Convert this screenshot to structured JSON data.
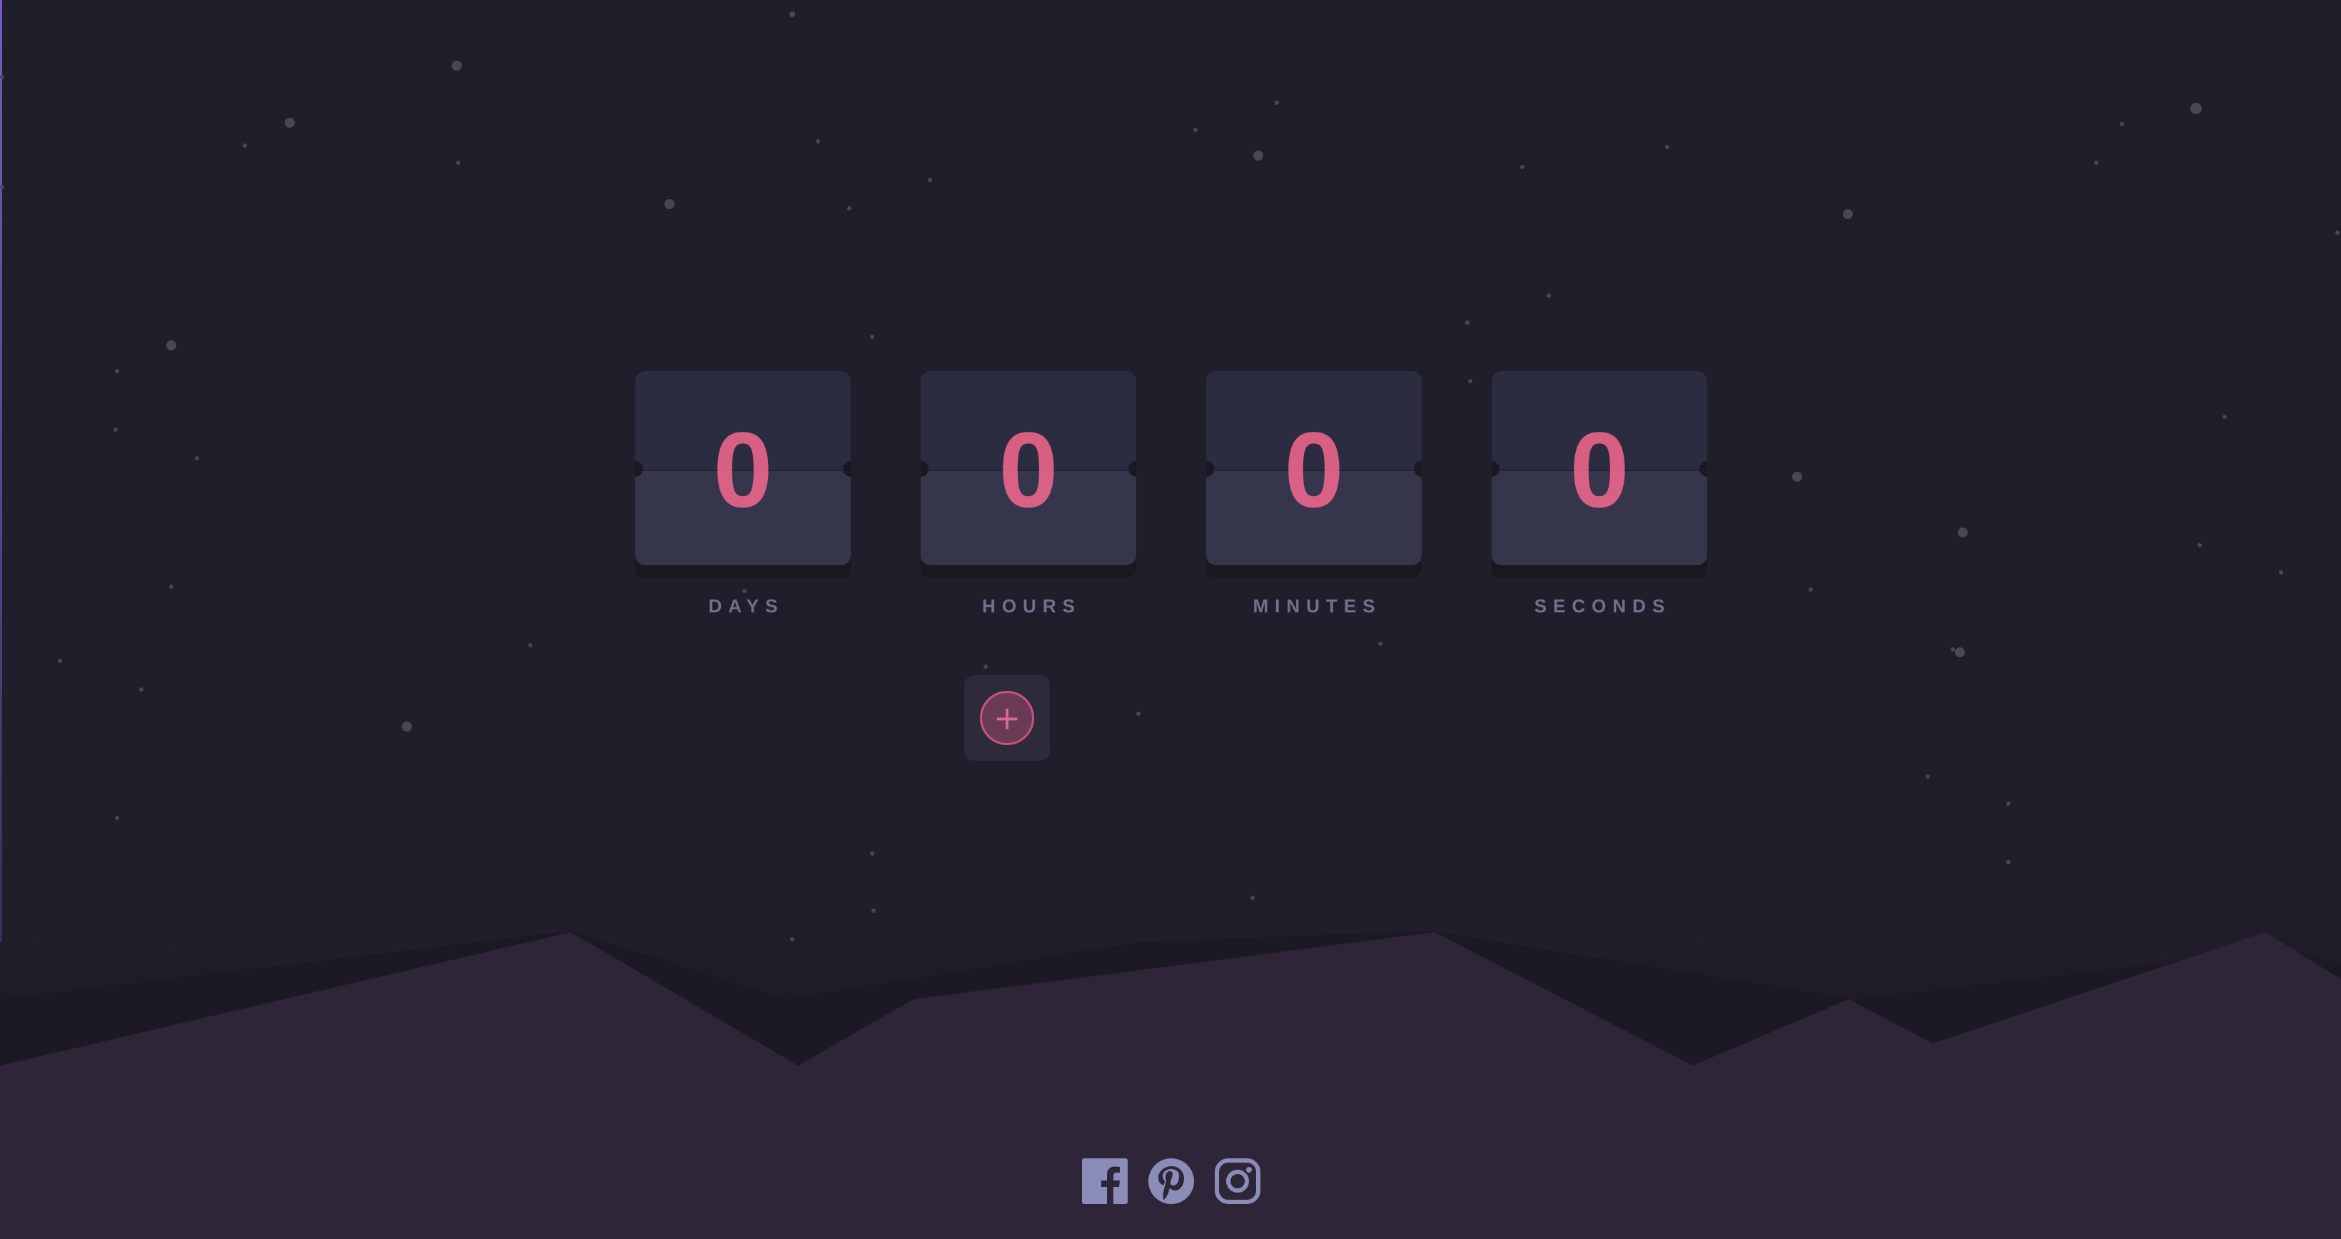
{
  "countdown": {
    "units": [
      {
        "id": "days",
        "value": "0",
        "label": "DAYS"
      },
      {
        "id": "hours",
        "value": "0",
        "label": "HOURS"
      },
      {
        "id": "minutes",
        "value": "0",
        "label": "MINUTES"
      },
      {
        "id": "seconds",
        "value": "0",
        "label": "SECONDS"
      }
    ]
  },
  "add_button": {
    "icon": "plus-icon",
    "symbol": "+"
  },
  "footer": {
    "social_links": [
      {
        "name": "facebook",
        "icon": "facebook-icon"
      },
      {
        "name": "pinterest",
        "icon": "pinterest-icon"
      },
      {
        "name": "instagram",
        "icon": "instagram-icon"
      }
    ]
  },
  "colors": {
    "background": "#211e2b",
    "card": "#34344a",
    "accent": "#f5698f",
    "label": "#8486a9",
    "hills": "#2e2538",
    "social_icon": "#8c8cb8"
  }
}
